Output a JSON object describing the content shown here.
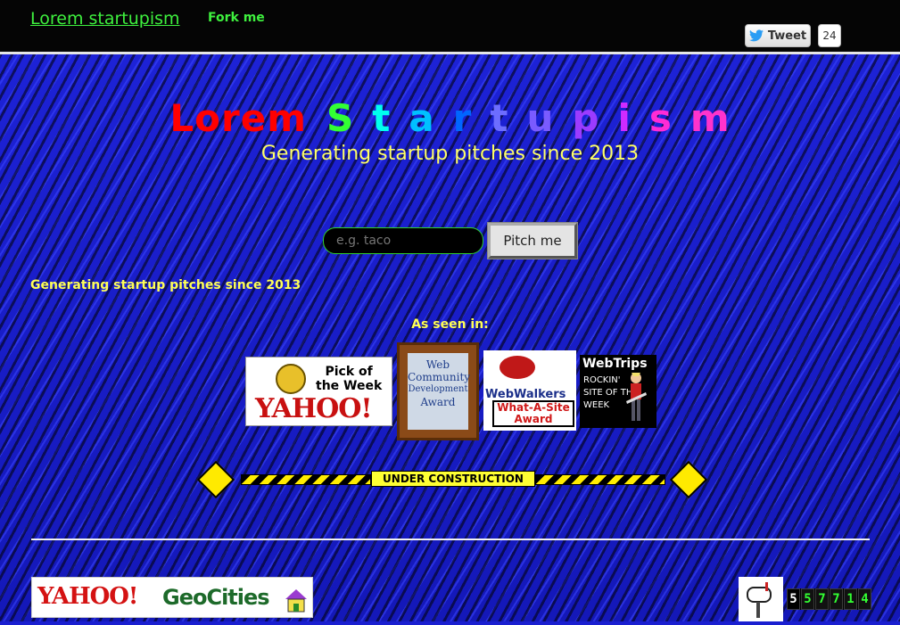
{
  "nav": {
    "brand": "Lorem startupism",
    "fork": "Fork me"
  },
  "twitter": {
    "tweet_label": "Tweet",
    "count": "24"
  },
  "hero": {
    "title_words": [
      "Lorem",
      "S",
      "t",
      "a",
      "r",
      "t",
      "u",
      "p",
      "i",
      "s",
      "m"
    ],
    "title_colors": [
      "#ff0000",
      "#33ff33",
      "#00ffee",
      "#00c0ff",
      "#0066ff",
      "#6d6dff",
      "#7a5bff",
      "#9b3bff",
      "#d02bff",
      "#ff2bd6",
      "#ff33cc"
    ],
    "subtitle": "Generating startup pitches since 2013"
  },
  "search": {
    "placeholder": "e.g. taco",
    "button": "Pitch me"
  },
  "marquee": "Generating startup pitches since 2013",
  "seen": "As seen in:",
  "badges": {
    "yahoo_pick": {
      "line1": "Pick of",
      "line2": "the Week",
      "brand": "YAHOO!"
    },
    "webcomm": {
      "text1": "Web",
      "text2": "Community",
      "text3": "Development",
      "text4": "Award"
    },
    "webwalkers": {
      "brand": "WebWalkers",
      "award1": "What-A-Site",
      "award2": "Award"
    },
    "webtrips": {
      "brand": "WebTrips",
      "line1": "ROCKIN'",
      "line2": "SITE OF THE",
      "line3": "WEEK"
    }
  },
  "construction": {
    "label": "UNDER CONSTRUCTION"
  },
  "footer": {
    "geocities_yahoo": "YAHOO!",
    "geocities_name": "GeoCities",
    "counter": [
      "5",
      "5",
      "7",
      "7",
      "1",
      "4"
    ]
  },
  "colors": {
    "accent": "#3ef03e",
    "yellow": "#ffff55",
    "background": "#1a1fd0"
  }
}
